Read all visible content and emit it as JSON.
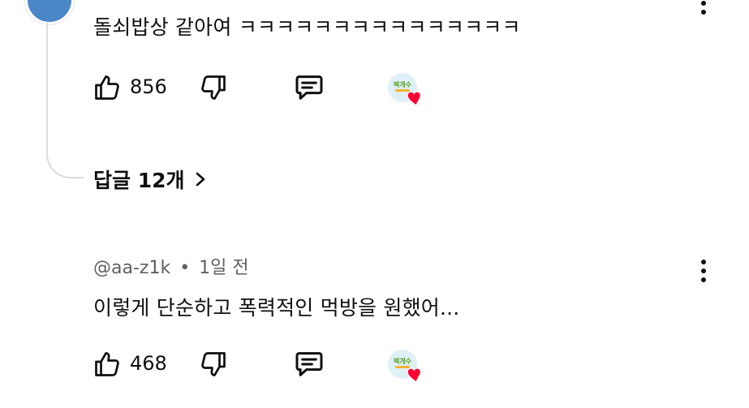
{
  "comment1": {
    "text": "돌쇠밥상 같아여 ㅋㅋㅋㅋㅋㅋㅋㅋㅋㅋㅋㅋㅋㅋㅋ",
    "likes": "856"
  },
  "replies": {
    "label": "답글 12개"
  },
  "comment2": {
    "handle": "@aa-z1k",
    "separator": "•",
    "time": "1일 전",
    "text": "이렇게 단순하고 폭력적인 먹방을 원했어...",
    "likes": "468"
  },
  "creator_badge": {
    "logo_text": "떡개수"
  },
  "colors": {
    "heart": "#ff0033",
    "text": "#0f0f0f",
    "meta": "#606060",
    "line": "#dcdcdc"
  }
}
